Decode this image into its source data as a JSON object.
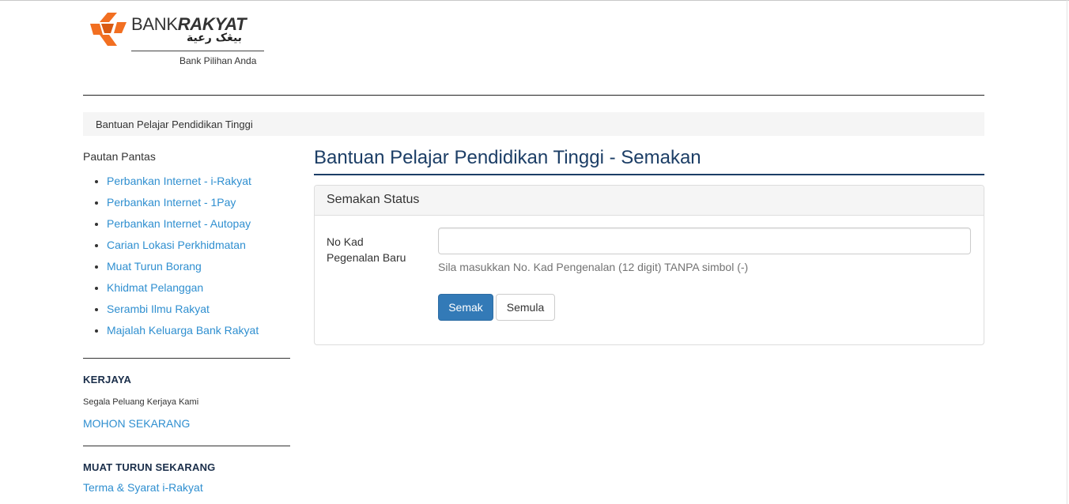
{
  "logo": {
    "brand_light": "BANK",
    "brand_bold": "RAKYAT",
    "jawi": "بيڠک رعية",
    "tagline": "Bank Pilihan Anda"
  },
  "breadcrumb": {
    "current": "Bantuan Pelajar Pendidikan Tinggi"
  },
  "sidebar": {
    "heading": "Pautan Pantas",
    "links": [
      "Perbankan Internet - i-Rakyat",
      "Perbankan Internet - 1Pay",
      "Perbankan Internet - Autopay",
      "Carian Lokasi Perkhidmatan",
      "Muat Turun Borang",
      "Khidmat Pelanggan",
      "Serambi Ilmu Rakyat",
      "Majalah Keluarga Bank Rakyat"
    ],
    "career": {
      "title": "KERJAYA",
      "text": "Segala Peluang Kerjaya Kami",
      "link": "MOHON SEKARANG"
    },
    "download": {
      "title": "MUAT TURUN SEKARANG",
      "link": "Terma & Syarat i-Rakyat"
    }
  },
  "main": {
    "title": "Bantuan Pelajar Pendidikan Tinggi - Semakan",
    "panel": {
      "heading": "Semakan Status",
      "field_label_line1": "No Kad",
      "field_label_line2": "Pegenalan Baru",
      "input_value": "",
      "input_placeholder": "",
      "help": "Sila masukkan No. Kad Pengenalan (12 digit) TANPA simbol (-)",
      "submit_label": "Semak",
      "reset_label": "Semula"
    }
  },
  "colors": {
    "accent": "#337ab7",
    "title": "#1c3e66",
    "link": "#2f8fd0",
    "logo_orange": "#f26f21"
  }
}
